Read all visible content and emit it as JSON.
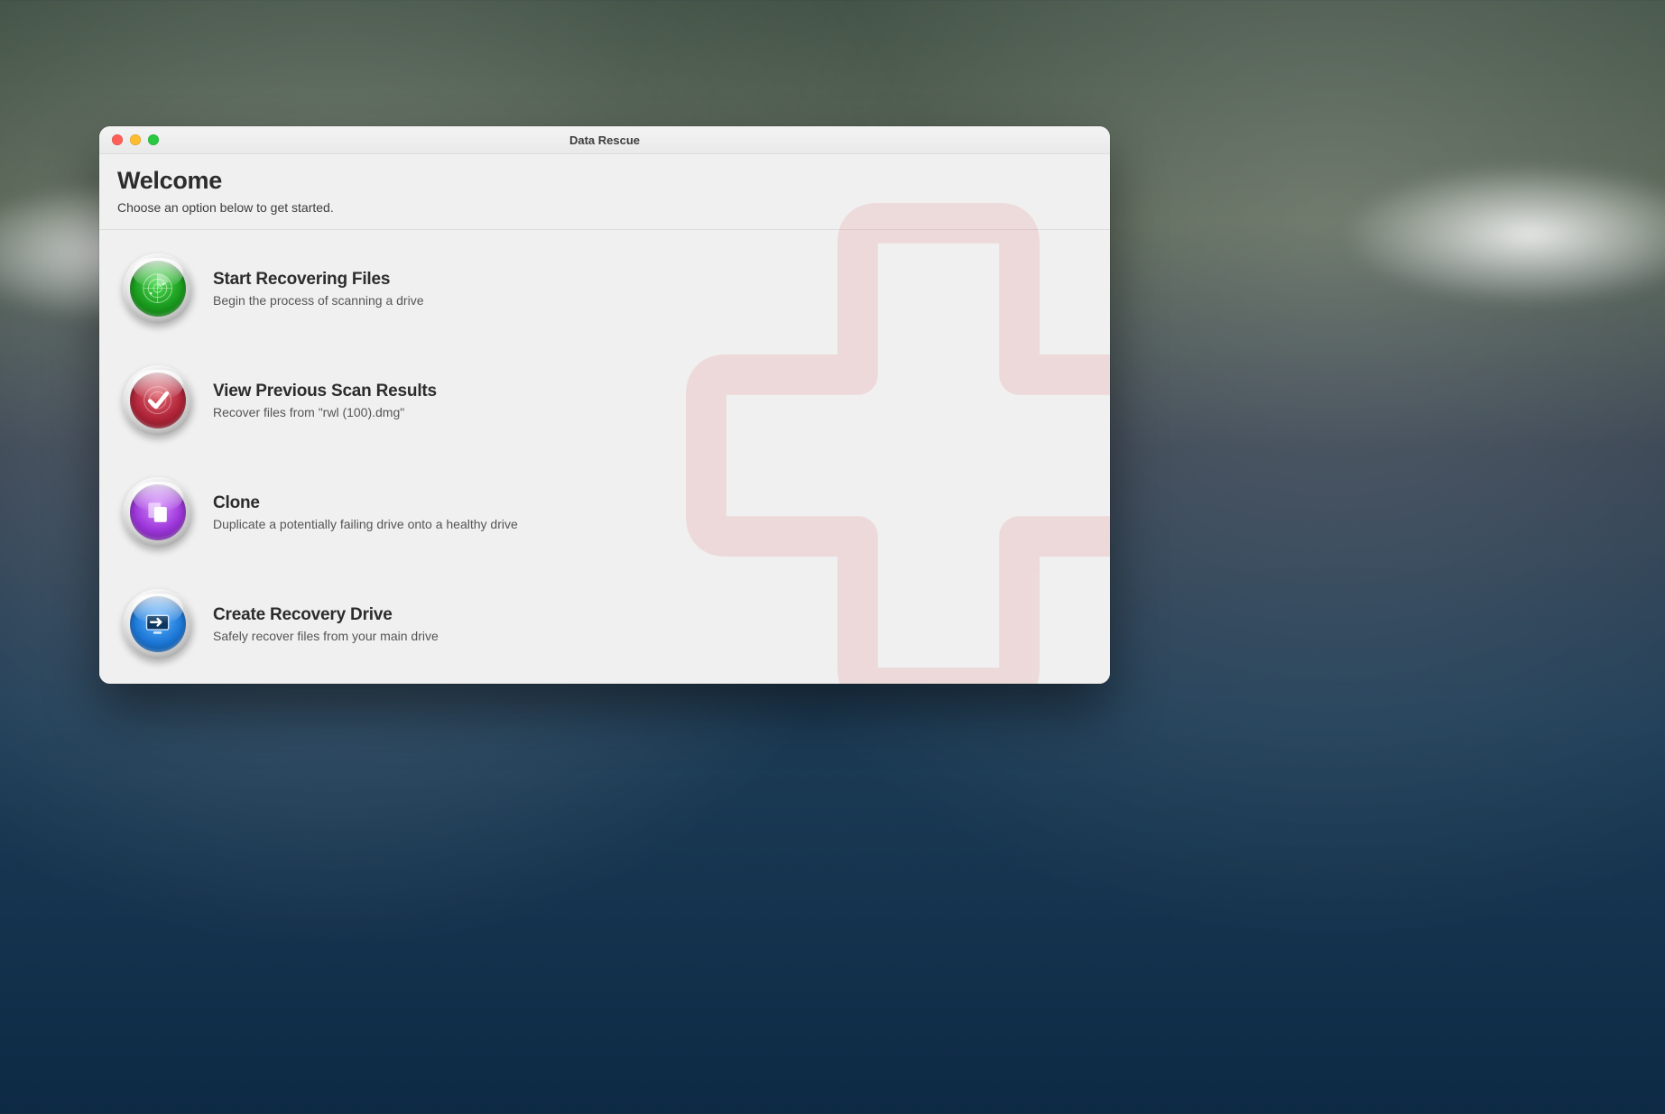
{
  "window": {
    "title": "Data Rescue"
  },
  "header": {
    "title": "Welcome",
    "subtitle": "Choose an option below to get started."
  },
  "options": {
    "recover": {
      "title": "Start Recovering Files",
      "desc": "Begin the process of scanning a drive"
    },
    "previous": {
      "title": "View Previous Scan Results",
      "desc": "Recover files from \"rwl (100).dmg\""
    },
    "clone": {
      "title": "Clone",
      "desc": "Duplicate a potentially failing drive onto a healthy drive"
    },
    "create": {
      "title": "Create Recovery Drive",
      "desc": "Safely recover files from your main drive"
    }
  },
  "colors": {
    "cross": "#e9a7ad"
  }
}
